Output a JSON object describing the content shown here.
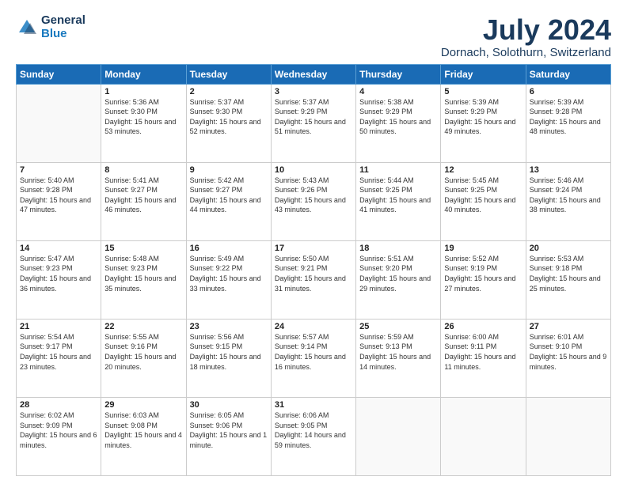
{
  "header": {
    "logo_general": "General",
    "logo_blue": "Blue",
    "title": "July 2024",
    "subtitle": "Dornach, Solothurn, Switzerland"
  },
  "weekdays": [
    "Sunday",
    "Monday",
    "Tuesday",
    "Wednesday",
    "Thursday",
    "Friday",
    "Saturday"
  ],
  "weeks": [
    [
      {
        "day": "",
        "empty": true
      },
      {
        "day": "1",
        "sunrise": "Sunrise: 5:36 AM",
        "sunset": "Sunset: 9:30 PM",
        "daylight": "Daylight: 15 hours and 53 minutes."
      },
      {
        "day": "2",
        "sunrise": "Sunrise: 5:37 AM",
        "sunset": "Sunset: 9:30 PM",
        "daylight": "Daylight: 15 hours and 52 minutes."
      },
      {
        "day": "3",
        "sunrise": "Sunrise: 5:37 AM",
        "sunset": "Sunset: 9:29 PM",
        "daylight": "Daylight: 15 hours and 51 minutes."
      },
      {
        "day": "4",
        "sunrise": "Sunrise: 5:38 AM",
        "sunset": "Sunset: 9:29 PM",
        "daylight": "Daylight: 15 hours and 50 minutes."
      },
      {
        "day": "5",
        "sunrise": "Sunrise: 5:39 AM",
        "sunset": "Sunset: 9:29 PM",
        "daylight": "Daylight: 15 hours and 49 minutes."
      },
      {
        "day": "6",
        "sunrise": "Sunrise: 5:39 AM",
        "sunset": "Sunset: 9:28 PM",
        "daylight": "Daylight: 15 hours and 48 minutes."
      }
    ],
    [
      {
        "day": "7",
        "sunrise": "Sunrise: 5:40 AM",
        "sunset": "Sunset: 9:28 PM",
        "daylight": "Daylight: 15 hours and 47 minutes."
      },
      {
        "day": "8",
        "sunrise": "Sunrise: 5:41 AM",
        "sunset": "Sunset: 9:27 PM",
        "daylight": "Daylight: 15 hours and 46 minutes."
      },
      {
        "day": "9",
        "sunrise": "Sunrise: 5:42 AM",
        "sunset": "Sunset: 9:27 PM",
        "daylight": "Daylight: 15 hours and 44 minutes."
      },
      {
        "day": "10",
        "sunrise": "Sunrise: 5:43 AM",
        "sunset": "Sunset: 9:26 PM",
        "daylight": "Daylight: 15 hours and 43 minutes."
      },
      {
        "day": "11",
        "sunrise": "Sunrise: 5:44 AM",
        "sunset": "Sunset: 9:25 PM",
        "daylight": "Daylight: 15 hours and 41 minutes."
      },
      {
        "day": "12",
        "sunrise": "Sunrise: 5:45 AM",
        "sunset": "Sunset: 9:25 PM",
        "daylight": "Daylight: 15 hours and 40 minutes."
      },
      {
        "day": "13",
        "sunrise": "Sunrise: 5:46 AM",
        "sunset": "Sunset: 9:24 PM",
        "daylight": "Daylight: 15 hours and 38 minutes."
      }
    ],
    [
      {
        "day": "14",
        "sunrise": "Sunrise: 5:47 AM",
        "sunset": "Sunset: 9:23 PM",
        "daylight": "Daylight: 15 hours and 36 minutes."
      },
      {
        "day": "15",
        "sunrise": "Sunrise: 5:48 AM",
        "sunset": "Sunset: 9:23 PM",
        "daylight": "Daylight: 15 hours and 35 minutes."
      },
      {
        "day": "16",
        "sunrise": "Sunrise: 5:49 AM",
        "sunset": "Sunset: 9:22 PM",
        "daylight": "Daylight: 15 hours and 33 minutes."
      },
      {
        "day": "17",
        "sunrise": "Sunrise: 5:50 AM",
        "sunset": "Sunset: 9:21 PM",
        "daylight": "Daylight: 15 hours and 31 minutes."
      },
      {
        "day": "18",
        "sunrise": "Sunrise: 5:51 AM",
        "sunset": "Sunset: 9:20 PM",
        "daylight": "Daylight: 15 hours and 29 minutes."
      },
      {
        "day": "19",
        "sunrise": "Sunrise: 5:52 AM",
        "sunset": "Sunset: 9:19 PM",
        "daylight": "Daylight: 15 hours and 27 minutes."
      },
      {
        "day": "20",
        "sunrise": "Sunrise: 5:53 AM",
        "sunset": "Sunset: 9:18 PM",
        "daylight": "Daylight: 15 hours and 25 minutes."
      }
    ],
    [
      {
        "day": "21",
        "sunrise": "Sunrise: 5:54 AM",
        "sunset": "Sunset: 9:17 PM",
        "daylight": "Daylight: 15 hours and 23 minutes."
      },
      {
        "day": "22",
        "sunrise": "Sunrise: 5:55 AM",
        "sunset": "Sunset: 9:16 PM",
        "daylight": "Daylight: 15 hours and 20 minutes."
      },
      {
        "day": "23",
        "sunrise": "Sunrise: 5:56 AM",
        "sunset": "Sunset: 9:15 PM",
        "daylight": "Daylight: 15 hours and 18 minutes."
      },
      {
        "day": "24",
        "sunrise": "Sunrise: 5:57 AM",
        "sunset": "Sunset: 9:14 PM",
        "daylight": "Daylight: 15 hours and 16 minutes."
      },
      {
        "day": "25",
        "sunrise": "Sunrise: 5:59 AM",
        "sunset": "Sunset: 9:13 PM",
        "daylight": "Daylight: 15 hours and 14 minutes."
      },
      {
        "day": "26",
        "sunrise": "Sunrise: 6:00 AM",
        "sunset": "Sunset: 9:11 PM",
        "daylight": "Daylight: 15 hours and 11 minutes."
      },
      {
        "day": "27",
        "sunrise": "Sunrise: 6:01 AM",
        "sunset": "Sunset: 9:10 PM",
        "daylight": "Daylight: 15 hours and 9 minutes."
      }
    ],
    [
      {
        "day": "28",
        "sunrise": "Sunrise: 6:02 AM",
        "sunset": "Sunset: 9:09 PM",
        "daylight": "Daylight: 15 hours and 6 minutes."
      },
      {
        "day": "29",
        "sunrise": "Sunrise: 6:03 AM",
        "sunset": "Sunset: 9:08 PM",
        "daylight": "Daylight: 15 hours and 4 minutes."
      },
      {
        "day": "30",
        "sunrise": "Sunrise: 6:05 AM",
        "sunset": "Sunset: 9:06 PM",
        "daylight": "Daylight: 15 hours and 1 minute."
      },
      {
        "day": "31",
        "sunrise": "Sunrise: 6:06 AM",
        "sunset": "Sunset: 9:05 PM",
        "daylight": "Daylight: 14 hours and 59 minutes."
      },
      {
        "day": "",
        "empty": true
      },
      {
        "day": "",
        "empty": true
      },
      {
        "day": "",
        "empty": true
      }
    ]
  ]
}
